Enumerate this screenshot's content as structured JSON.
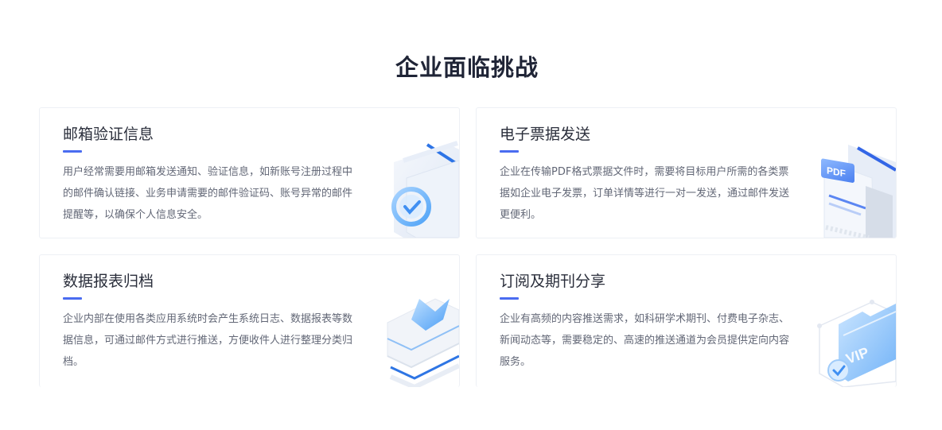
{
  "section": {
    "title": "企业面临挑战"
  },
  "cards": [
    {
      "title": "邮箱验证信息",
      "desc": "用户经常需要用邮箱发送通知、验证信息，如新账号注册过程中的邮件确认链接、业务申请需要的邮件验证码、账号异常的邮件提醒等，以确保个人信息安全。",
      "icon": "verify-check-icon"
    },
    {
      "title": "电子票据发送",
      "desc": "企业在传输PDF格式票据文件时，需要将目标用户所需的各类票据如企业电子发票，订单详情等进行一对一发送，通过邮件发送更便利。",
      "icon": "pdf-document-icon",
      "icon_text": "PDF"
    },
    {
      "title": "数据报表归档",
      "desc": "企业内部在使用各类应用系统时会产生系统日志、数据报表等数据信息，可通过邮件方式进行推送，方便收件人进行整理分类归档。",
      "icon": "archive-layers-icon"
    },
    {
      "title": "订阅及期刊分享",
      "desc": "企业有高频的内容推送需求，如科研学术期刊、付费电子杂志、新闻动态等，需要稳定的、高速的推送通道为会员提供定向内容服务。",
      "icon": "vip-folder-icon",
      "icon_text": "VIP"
    }
  ],
  "colors": {
    "accent": "#4a6cf0",
    "title": "#1f2436",
    "text": "#626776"
  }
}
